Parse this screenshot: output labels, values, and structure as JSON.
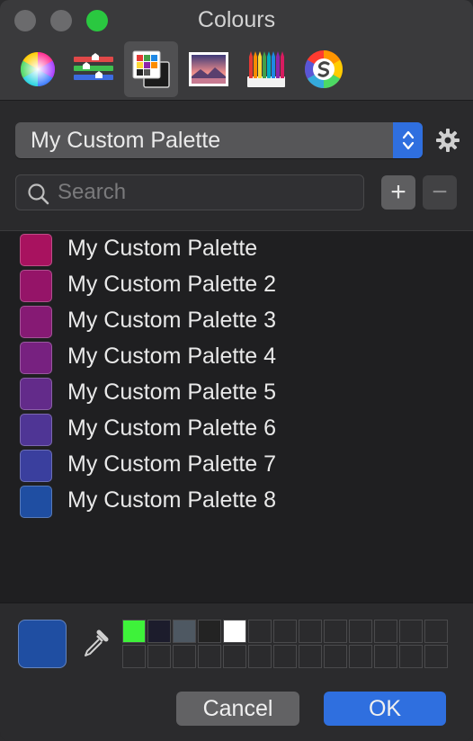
{
  "window": {
    "title": "Colours"
  },
  "toolbar": {
    "tools": [
      {
        "id": "colour-wheel",
        "icon": "colour-wheel-icon"
      },
      {
        "id": "colour-sliders",
        "icon": "colour-sliders-icon"
      },
      {
        "id": "colour-palettes",
        "icon": "colour-palettes-icon",
        "selected": true
      },
      {
        "id": "image-palettes",
        "icon": "image-palettes-icon"
      },
      {
        "id": "pencils",
        "icon": "pencils-icon"
      },
      {
        "id": "sip-colour",
        "icon": "sip-icon"
      }
    ]
  },
  "palette_selector": {
    "value": "My Custom Palette",
    "icon": "gear-icon"
  },
  "search": {
    "placeholder": "Search"
  },
  "buttons": {
    "add_label": "+",
    "remove_label": "−",
    "cancel": "Cancel",
    "ok": "OK"
  },
  "palettes": [
    {
      "name": "My Custom Palette",
      "color": "#a8125f"
    },
    {
      "name": "My Custom Palette 2",
      "color": "#951468"
    },
    {
      "name": "My Custom Palette 3",
      "color": "#861a74"
    },
    {
      "name": "My Custom Palette 4",
      "color": "#772180"
    },
    {
      "name": "My Custom Palette 5",
      "color": "#632b8a"
    },
    {
      "name": "My Custom Palette 6",
      "color": "#4f3595"
    },
    {
      "name": "My Custom Palette 7",
      "color": "#3a3f9e"
    },
    {
      "name": "My Custom Palette 8",
      "color": "#1f4ea2"
    }
  ],
  "current_colour": "#1f4ea2",
  "colour_wells": [
    "#3ef23a",
    "#1c1c2c",
    "#4e5862",
    "#232323",
    "#ffffff"
  ],
  "colors": {
    "accent": "#2f6fdf"
  }
}
